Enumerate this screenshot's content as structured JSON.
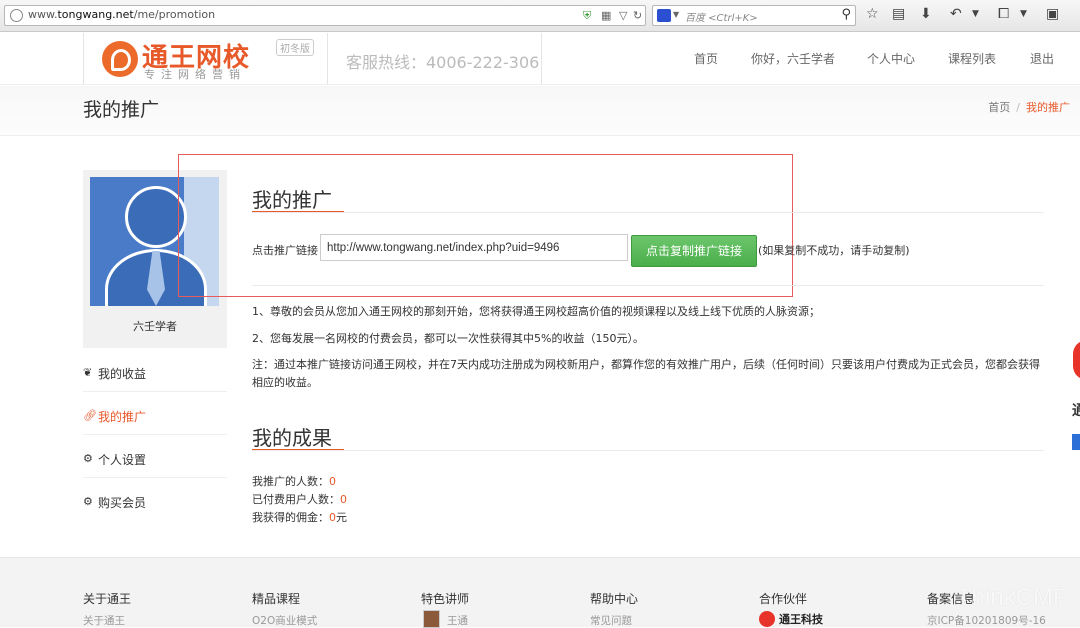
{
  "browser": {
    "url_prefix": "www.",
    "url_domain": "tongwang.net",
    "url_path": "/me/promotion",
    "search_placeholder": "百度 <Ctrl+K>"
  },
  "header": {
    "logo_name": "通王网校",
    "logo_badge": "初冬版",
    "logo_slogan": "专注网络营销",
    "hotline": "客服热线：4006-222-306",
    "nav": [
      "首页",
      "你好，六壬学者",
      "个人中心",
      "课程列表",
      "退出"
    ]
  },
  "title_band": {
    "title": "我的推广",
    "breadcrumb_home": "首页",
    "breadcrumb_sep": "/",
    "breadcrumb_current": "我的推广"
  },
  "sidebar": {
    "username": "六壬学者",
    "items": [
      {
        "label": "我的收益",
        "icon": "leaf-icon"
      },
      {
        "label": "我的推广",
        "icon": "link-icon"
      },
      {
        "label": "个人设置",
        "icon": "gear-icon"
      },
      {
        "label": "购买会员",
        "icon": "gear-icon"
      }
    ]
  },
  "promotion": {
    "title": "我的推广",
    "link_label": "点击推广链接",
    "link_value": "http://www.tongwang.net/index.php?uid=9496",
    "copy_button": "点击复制推广链接",
    "copy_hint": "(如果复制不成功，请手动复制)",
    "desc1": "1、尊敬的会员从您加入通王网校的那刻开始，您将获得通王网校超高价值的视频课程以及线上线下优质的人脉资源；",
    "desc2": "2、您每发展一名网校的付费会员，都可以一次性获得其中5%的收益（150元）。",
    "note": "注：通过本推广链接访问通王网校，并在7天内成功注册成为网校新用户，都算作您的有效推广用户，后续（任何时间）只要该用户付费成为正式会员，您都会获得相应的收益。"
  },
  "results": {
    "title": "我的成果",
    "promoted_label": "我推广的人数：",
    "promoted_value": "0",
    "paid_label": "已付费用户人数：",
    "paid_value": "0",
    "commission_label": "我获得的佣金：",
    "commission_value": "0",
    "commission_unit": "元"
  },
  "right_float": {
    "text": "通"
  },
  "footer": {
    "cols": [
      {
        "head": "关于通王",
        "sub": "关于通王"
      },
      {
        "head": "精品课程",
        "sub": "O2O商业模式"
      },
      {
        "head": "特色讲师",
        "sub": "王通"
      },
      {
        "head": "帮助中心",
        "sub": "常见问题"
      },
      {
        "head": "合作伙伴",
        "sub": "通王科技"
      },
      {
        "head": "备案信息",
        "sub": "京ICP备10201809号-16"
      }
    ],
    "watermark": "ThinkCMF"
  },
  "colors": {
    "accent": "#e8592a",
    "button_green": "#5cb85c",
    "highlight_box": "#e85a5a"
  }
}
